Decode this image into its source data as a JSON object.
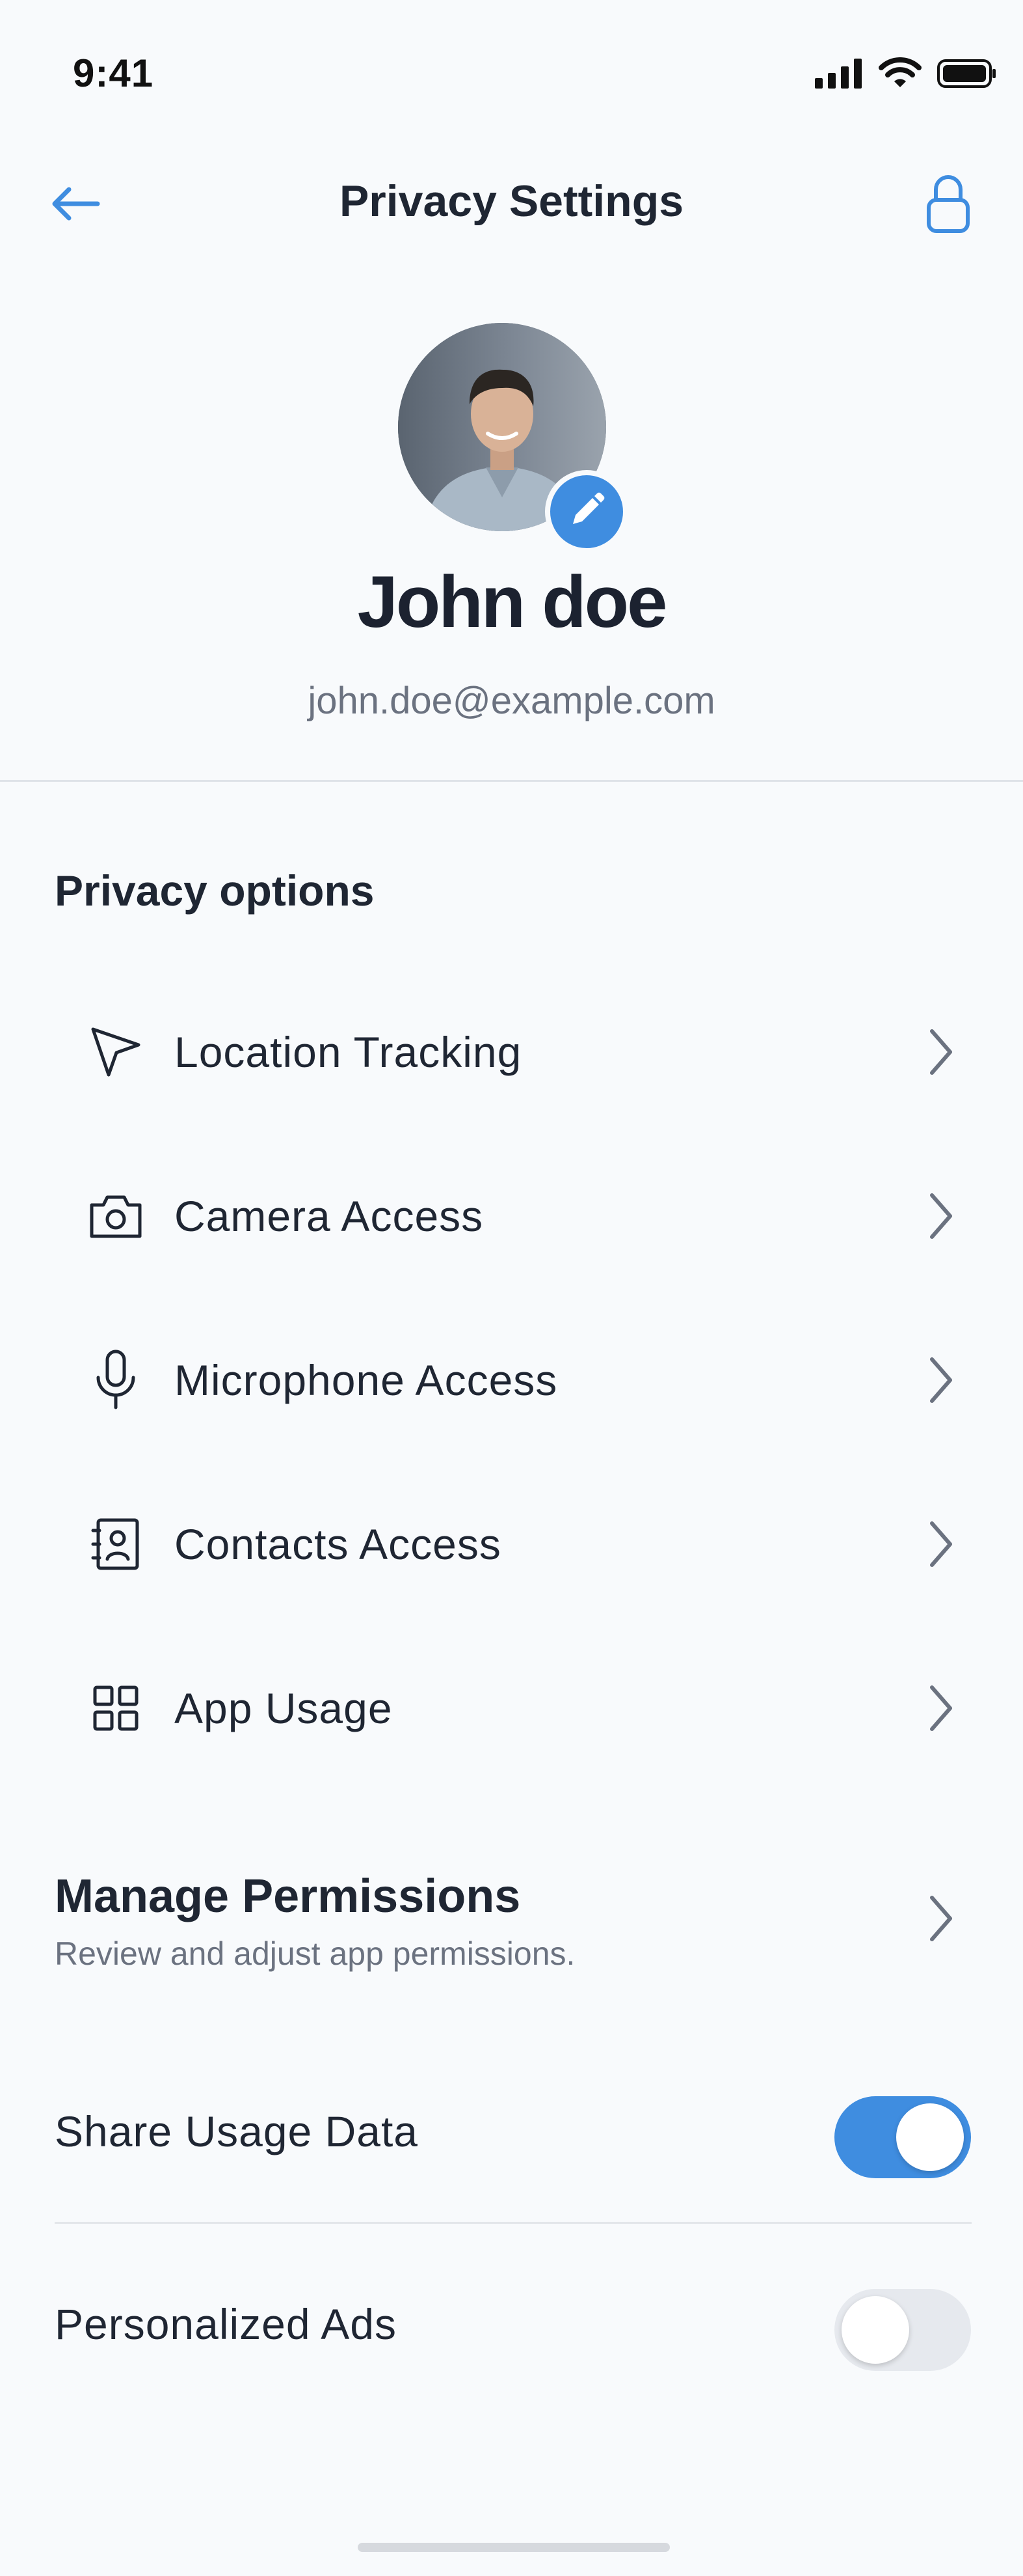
{
  "status_bar": {
    "time": "9:41",
    "icons": [
      "signal-icon",
      "wifi-icon",
      "battery-icon"
    ]
  },
  "header": {
    "title": "Privacy Settings",
    "back_icon": "arrow-left-icon",
    "right_icon": "lock-icon"
  },
  "profile": {
    "name": "John doe",
    "email": "john.doe@example.com",
    "edit_icon": "pencil-icon"
  },
  "privacy_options": {
    "title": "Privacy options",
    "items": [
      {
        "label": "Location Tracking",
        "icon": "location-arrow-icon"
      },
      {
        "label": "Camera Access",
        "icon": "camera-icon"
      },
      {
        "label": "Microphone Access",
        "icon": "microphone-icon"
      },
      {
        "label": "Contacts Access",
        "icon": "contacts-icon"
      },
      {
        "label": "App Usage",
        "icon": "grid-icon"
      }
    ]
  },
  "manage_permissions": {
    "title": "Manage Permissions",
    "subtitle": "Review and adjust app permissions."
  },
  "toggles": [
    {
      "label": "Share Usage Data",
      "enabled": true
    },
    {
      "label": "Personalized Ads",
      "enabled": false
    }
  ],
  "colors": {
    "accent": "#3f8de0",
    "background": "#f8fafc",
    "text": "#1f2633",
    "muted": "#6b7280"
  }
}
